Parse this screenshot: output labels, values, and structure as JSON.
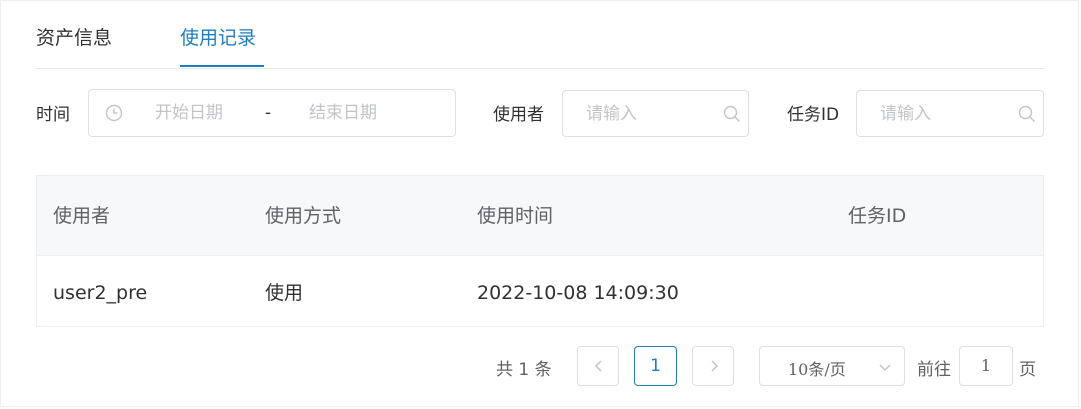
{
  "tabs": [
    {
      "label": "资产信息"
    },
    {
      "label": "使用记录"
    }
  ],
  "filters": {
    "time_label": "时间",
    "start_placeholder": "开始日期",
    "separator": "-",
    "end_placeholder": "结束日期",
    "user_label": "使用者",
    "user_placeholder": "请输入",
    "task_label": "任务ID",
    "task_placeholder": "请输入"
  },
  "table": {
    "columns": [
      "使用者",
      "使用方式",
      "使用时间",
      "任务ID"
    ],
    "rows": [
      [
        "user2_pre",
        "使用",
        "2022-10-08 14:09:30",
        ""
      ]
    ]
  },
  "pagination": {
    "total_text": "共 1 条",
    "current_page": "1",
    "page_size": "10条/页",
    "goto_prefix": "前往",
    "goto_value": "1",
    "goto_suffix": "页"
  },
  "colors": {
    "accent": "#1d7fbf",
    "border": "#dcdfe6",
    "header_bg": "#f7f8fa"
  },
  "icons": {
    "date": "clock-icon",
    "search": "search-icon",
    "prev": "chevron-left-icon",
    "next": "chevron-right-icon",
    "dropdown": "chevron-down-icon"
  }
}
